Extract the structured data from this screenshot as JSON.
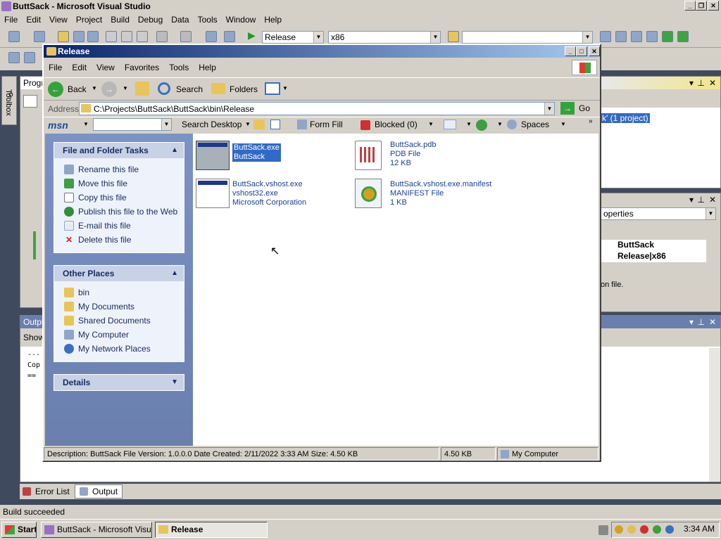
{
  "vs": {
    "title": "ButtSack - Microsoft Visual Studio",
    "menu": [
      "File",
      "Edit",
      "View",
      "Project",
      "Build",
      "Debug",
      "Data",
      "Tools",
      "Window",
      "Help"
    ],
    "config_combo": "Release",
    "platform_combo": "x86",
    "toolbox_label": "Toolbox",
    "solution_panel_title": "Progr",
    "output_panel_title": "Outpu",
    "output_show_label": "Show",
    "output_lines": [
      "---",
      "Cop",
      "=="
    ],
    "solution_fragment": "k' (1 project)",
    "props_combo": "operties",
    "props_rows": [
      {
        "key": "",
        "val": "ButtSack"
      },
      {
        "key": "",
        "val": "Release|x86"
      }
    ],
    "props_desc": "on file.",
    "status": "Build succeeded",
    "bottom_tabs": [
      "Error List",
      "Output"
    ]
  },
  "taskbar": {
    "start": "Start",
    "buttons": [
      "ButtSack - Microsoft Visu...",
      "Release"
    ],
    "clock": "3:34 AM"
  },
  "explorer": {
    "title": "Release",
    "menu": [
      "File",
      "Edit",
      "View",
      "Favorites",
      "Tools",
      "Help"
    ],
    "back_label": "Back",
    "search_label": "Search",
    "folders_label": "Folders",
    "address_label": "Address",
    "address_value": "C:\\Projects\\ButtSack\\ButtSack\\bin\\Release",
    "go_label": "Go",
    "links": {
      "msn": "msn",
      "search_desktop": "Search Desktop",
      "form_fill": "Form Fill",
      "blocked": "Blocked (0)",
      "spaces": "Spaces"
    },
    "file_tasks": {
      "title": "File and Folder Tasks",
      "items": [
        "Rename this file",
        "Move this file",
        "Copy this file",
        "Publish this file to the Web",
        "E-mail this file",
        "Delete this file"
      ]
    },
    "other_places": {
      "title": "Other Places",
      "items": [
        "bin",
        "My Documents",
        "Shared Documents",
        "My Computer",
        "My Network Places"
      ]
    },
    "details_title": "Details",
    "files": [
      {
        "name": "ButtSack.exe",
        "line2": "ButtSack",
        "line3": ""
      },
      {
        "name": "ButtSack.pdb",
        "line2": "PDB File",
        "line3": "12 KB"
      },
      {
        "name": "ButtSack.vshost.exe",
        "line2": "vshost32.exe",
        "line3": "Microsoft Corporation"
      },
      {
        "name": "ButtSack.vshost.exe.manifest",
        "line2": "MANIFEST File",
        "line3": "1 KB"
      }
    ],
    "status_desc": "Description: ButtSack File Version: 1.0.0.0 Date Created: 2/11/2022 3:33 AM Size: 4.50 KB",
    "status_size": "4.50 KB",
    "status_zone": "My Computer"
  },
  "colors": {
    "title_active": "#0a246a",
    "task_panel": "#6b82b5",
    "link_text": "#1a3e98"
  }
}
